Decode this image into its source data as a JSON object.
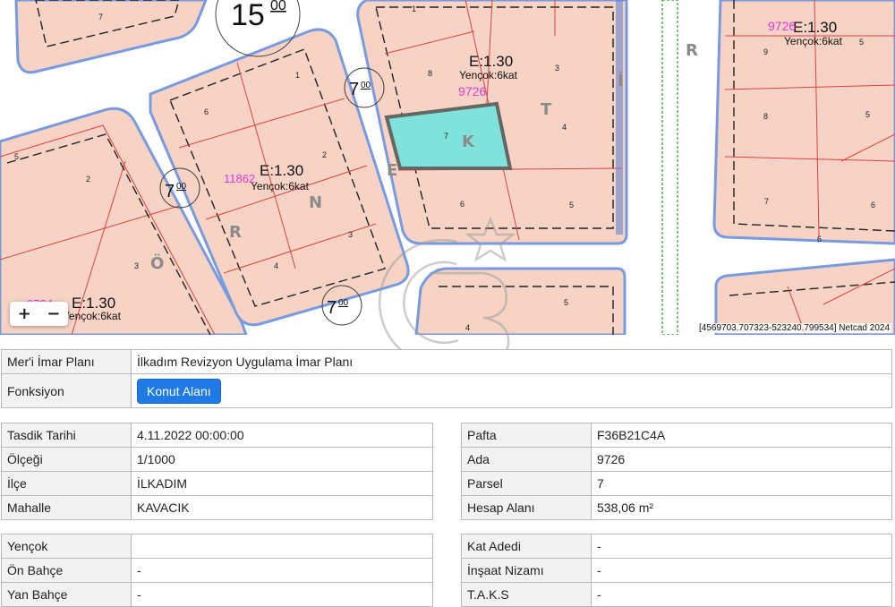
{
  "map": {
    "labels": {
      "b15": "15",
      "b15sup": "00",
      "b7a": "7",
      "b7asup": "00",
      "b7b": "7",
      "b7bsup": "00",
      "b7c": "7",
      "b7csup": "00",
      "zoneE1": "E:1.30",
      "yencok1": "Yençok:6kat",
      "ada9726": "9726",
      "zoneE2": "E:1.30",
      "yencok2": "Yençok:6kat",
      "ada11862": "11862",
      "zoneE3": "E:1.30",
      "yencok3": "Yençok:6kat",
      "ada972": "9726",
      "zoneE4": "E:1.30",
      "yencok4": "Yençok:6kat",
      "ada9724": "9724",
      "street1": [
        "Ö",
        "R",
        "N",
        "E",
        "K"
      ],
      "street2": [
        "T",
        "İ",
        "R"
      ],
      "parcel_nums": [
        "7",
        "5",
        "1",
        "8",
        "3",
        "4",
        "6",
        "5",
        "6",
        "1",
        "2",
        "3",
        "4",
        "2",
        "3",
        "5",
        "9",
        "8",
        "5",
        "7",
        "6",
        "7",
        "5",
        "6",
        "4"
      ]
    },
    "zoom_in": "+",
    "zoom_out": "−",
    "coords": "[4569703.707323-523240.799534] Netcad 2024"
  },
  "plan": {
    "rows": [
      {
        "label": "Mer'i İmar Planı",
        "value": "İlkadım Revizyon Uygulama İmar Planı"
      },
      {
        "label": "Fonksiyon",
        "button": "Konut Alanı"
      }
    ]
  },
  "left1": [
    {
      "label": "Tasdik Tarihi",
      "value": "4.11.2022 00:00:00"
    },
    {
      "label": "Ölçeği",
      "value": "1/1000"
    },
    {
      "label": "İlçe",
      "value": "İLKADIM"
    },
    {
      "label": "Mahalle",
      "value": "KAVACIK"
    }
  ],
  "right1": [
    {
      "label": "Pafta",
      "value": "F36B21C4A"
    },
    {
      "label": "Ada",
      "value": "9726"
    },
    {
      "label": "Parsel",
      "value": "7"
    },
    {
      "label": "Hesap Alanı",
      "value": "538,06 m²"
    }
  ],
  "left2": [
    {
      "label": "Yençok",
      "value": ""
    },
    {
      "label": "Ön Bahçe",
      "value": "-"
    },
    {
      "label": "Yan Bahçe",
      "value": "-"
    }
  ],
  "right2": [
    {
      "label": "Kat Adedi",
      "value": "-"
    },
    {
      "label": "İnşaat Nizamı",
      "value": "-"
    },
    {
      "label": "T.A.K.S",
      "value": "-"
    }
  ],
  "colors": {
    "block": "#f6d3c4",
    "parcel_line": "#e04040",
    "road_edge": "#5a7fd6",
    "highlight": "#7fe3dc",
    "label_magenta": "#e03adc",
    "button": "#1f7ae6"
  }
}
